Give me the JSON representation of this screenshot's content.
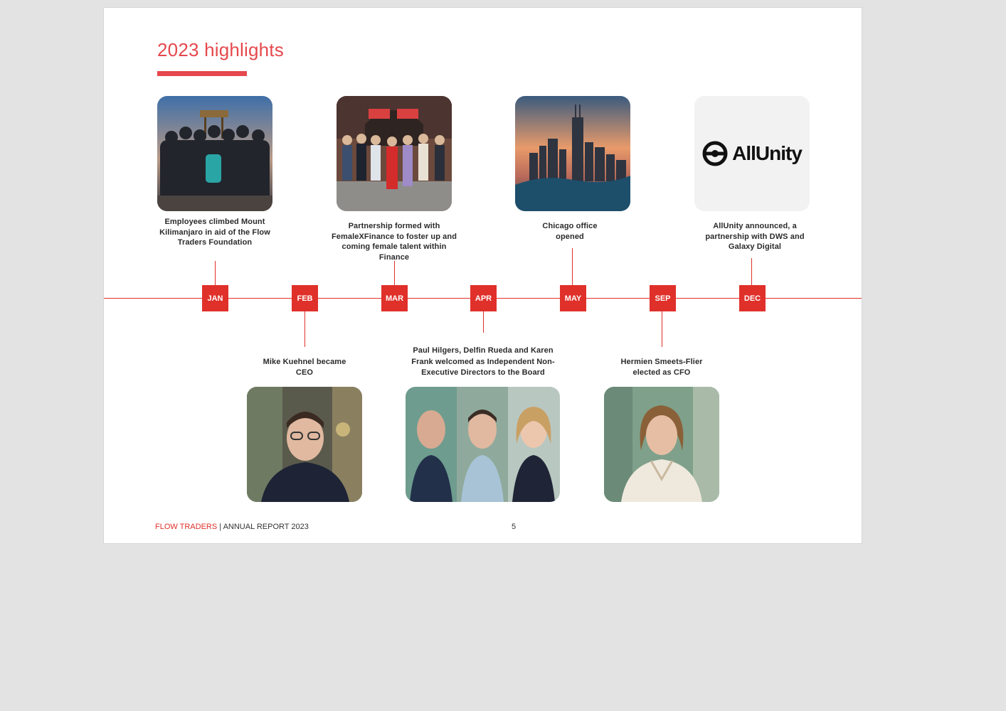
{
  "page": {
    "title": "2023 highlights"
  },
  "timeline": {
    "months": [
      "JAN",
      "FEB",
      "MAR",
      "APR",
      "MAY",
      "SEP",
      "DEC"
    ]
  },
  "events_top": [
    {
      "month": "JAN",
      "caption": "Employees climbed Mount Kilimanjaro in aid of the Flow Traders Foundation",
      "image": "mountain-summit-group-photo"
    },
    {
      "month": "MAR",
      "caption": "Partnership formed with FemaleXFinance to foster up and coming female talent within Finance",
      "image": "femalexfinance-group-photo"
    },
    {
      "month": "MAY",
      "caption": "Chicago office opened",
      "image": "chicago-skyline-photo"
    },
    {
      "month": "DEC",
      "caption": "AllUnity announced, a partnership with DWS and Galaxy Digital",
      "image": "allunity-logo"
    }
  ],
  "events_bottom": [
    {
      "month": "FEB",
      "caption": "Mike Kuehnel became CEO",
      "image": "portrait-photo"
    },
    {
      "month": "APR",
      "caption": "Paul Hilgers, Delfin Rueda and Karen Frank welcomed as Independent Non-Executive Directors to the Board",
      "image": "three-portraits-photo"
    },
    {
      "month": "SEP",
      "caption": "Hermien Smeets-Flier elected as CFO",
      "image": "portrait-photo"
    }
  ],
  "logo": {
    "text": "AllUnity"
  },
  "footer": {
    "brand": "FLOW TRADERS",
    "separator": " | ",
    "report": "ANNUAL REPORT 2023",
    "page_number": "5"
  },
  "colors": {
    "accent": "#e0302a",
    "title": "#e5484d",
    "background": "#e3e3e3",
    "page": "#ffffff"
  }
}
